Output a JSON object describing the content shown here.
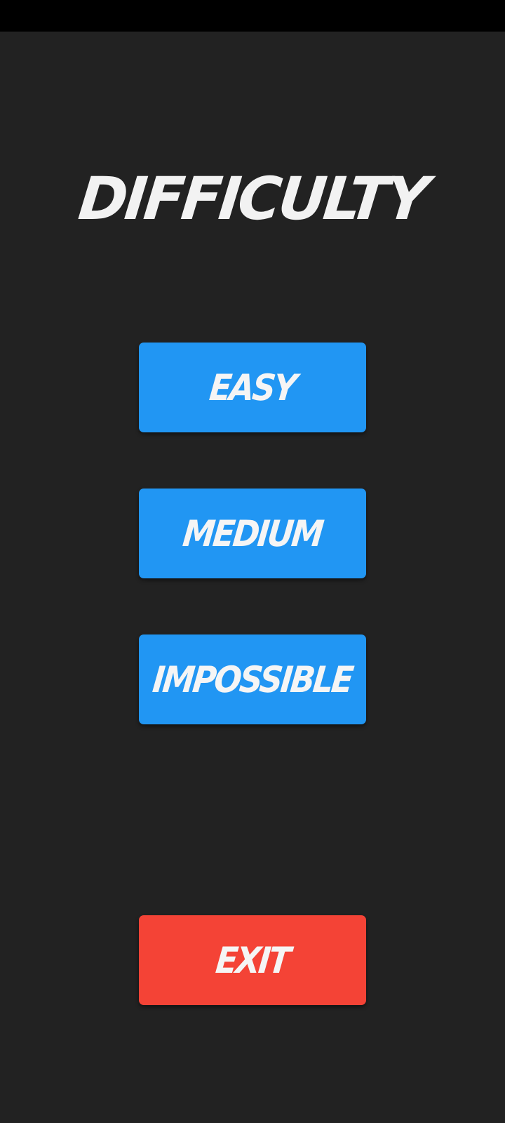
{
  "screen": {
    "title": "DIFFICULTY"
  },
  "buttons": {
    "easy_label": "EASY",
    "medium_label": "MEDIUM",
    "impossible_label": "IMPOSSIBLE",
    "exit_label": "EXIT"
  },
  "colors": {
    "background": "#222222",
    "status_bar": "#000000",
    "primary_button": "#2196f3",
    "exit_button": "#f44336",
    "text": "#f2f2f2"
  }
}
